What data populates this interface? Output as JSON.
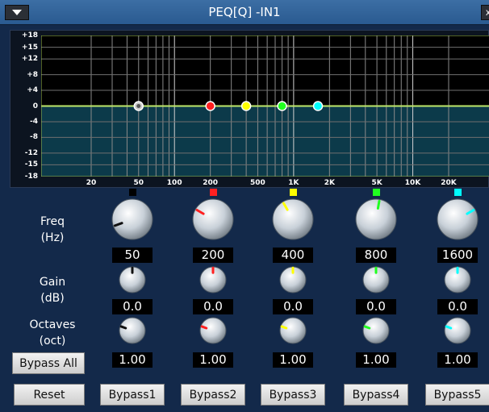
{
  "window": {
    "title": "PEQ[Q] -IN1",
    "close_glyph": "x"
  },
  "graph": {
    "y_ticks": [
      "+18",
      "+15",
      "+12",
      "+8",
      "+4",
      "0",
      "-4",
      "-8",
      "-12",
      "-15",
      "-18"
    ],
    "x_ticks": [
      "20",
      "50",
      "100",
      "200",
      "500",
      "1K",
      "2K",
      "5K",
      "10K",
      "20K"
    ]
  },
  "labels": {
    "freq": "Freq\n(Hz)",
    "gain": "Gain\n(dB)",
    "octaves": "Octaves\n(oct)"
  },
  "bands": [
    {
      "color": "#000000",
      "freq": "50",
      "gain": "0.0",
      "oct": "1.00",
      "bypass": "Bypass1"
    },
    {
      "color": "#ff2020",
      "freq": "200",
      "gain": "0.0",
      "oct": "1.00",
      "bypass": "Bypass2"
    },
    {
      "color": "#ffff00",
      "freq": "400",
      "gain": "0.0",
      "oct": "1.00",
      "bypass": "Bypass3"
    },
    {
      "color": "#20ff20",
      "freq": "800",
      "gain": "0.0",
      "oct": "1.00",
      "bypass": "Bypass4"
    },
    {
      "color": "#00ffff",
      "freq": "1600",
      "gain": "0.0",
      "oct": "1.00",
      "bypass": "Bypass5"
    }
  ],
  "buttons": {
    "bypass_all": "Bypass All",
    "reset": "Reset"
  }
}
